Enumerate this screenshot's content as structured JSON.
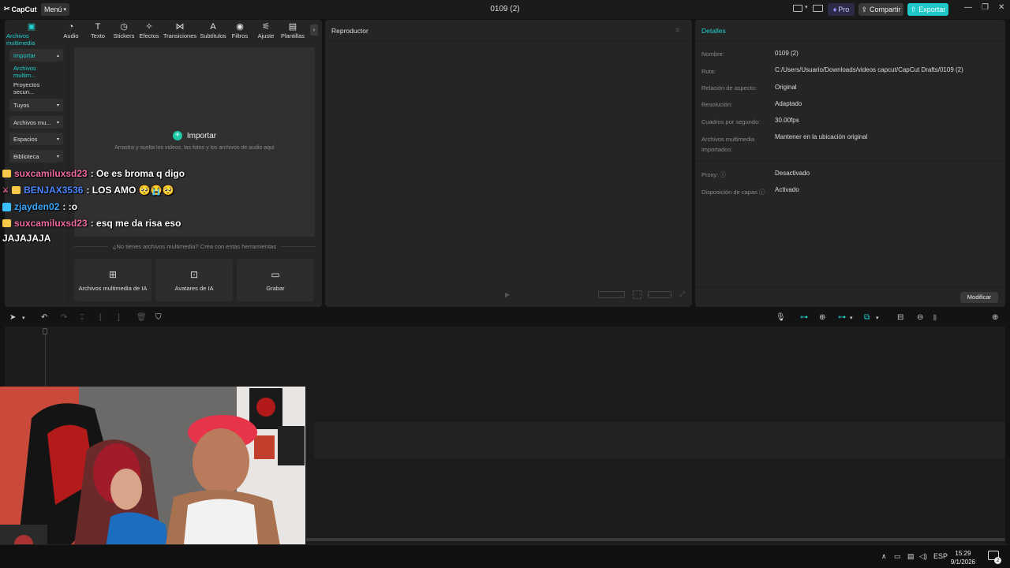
{
  "titlebar": {
    "logo": "CapCut",
    "menu": "Menú",
    "title": "0109 (2)",
    "pro": "Pro",
    "share": "Compartir",
    "export": "Exportar"
  },
  "media_tabs": [
    {
      "label": "Archivos multimedia",
      "icon": "media-icon"
    },
    {
      "label": "Audio",
      "icon": "audio-icon"
    },
    {
      "label": "Texto",
      "icon": "text-icon"
    },
    {
      "label": "Stickers",
      "icon": "sticker-icon"
    },
    {
      "label": "Efectos",
      "icon": "effects-icon"
    },
    {
      "label": "Transiciones",
      "icon": "transitions-icon"
    },
    {
      "label": "Subtítulos",
      "icon": "subtitles-icon"
    },
    {
      "label": "Filtros",
      "icon": "filters-icon"
    },
    {
      "label": "Ajuste",
      "icon": "adjust-icon"
    },
    {
      "label": "Plantillas",
      "icon": "templates-icon"
    }
  ],
  "sidebar": {
    "items": [
      {
        "label": "Importar"
      },
      {
        "label": "Archivos multim..."
      },
      {
        "label": "Proyectos secun..."
      },
      {
        "label": "Tuyos"
      },
      {
        "label": "Archivos mu..."
      },
      {
        "label": "Espacios"
      },
      {
        "label": "Biblioteca"
      }
    ]
  },
  "dropzone": {
    "title": "Importar",
    "subtitle": "Arrastra y suelta los videos, las fotos y los archivos de audio aquí"
  },
  "tools": {
    "prompt": "¿No tienes archivos multimedia? Crea con estas herramientas",
    "cards": [
      {
        "label": "Archivos multimedia de IA"
      },
      {
        "label": "Avatares de IA"
      },
      {
        "label": "Grabar"
      }
    ]
  },
  "player": {
    "title": "Reproductor"
  },
  "details": {
    "title": "Detalles",
    "rows": [
      {
        "label": "Nombre:",
        "value": "0109 (2)"
      },
      {
        "label": "Ruta:",
        "value": "C:/Users/Usuario/Downloads/videos capcut/CapCut Drafts/0109 (2)"
      },
      {
        "label": "Relación de aspecto:",
        "value": "Original"
      },
      {
        "label": "Resolución:",
        "value": "Adaptado"
      },
      {
        "label": "Cuadros por segundo:",
        "value": "30.00fps"
      },
      {
        "label": "Archivos multimedia importados:",
        "value": "Mantener en la ubicación original"
      },
      {
        "label": "Proxy:",
        "value": "Desactivado"
      },
      {
        "label": "Disposición de capas",
        "value": "Activado"
      }
    ],
    "modify": "Modificar"
  },
  "chat": [
    {
      "user": "suxcamiluxsd23",
      "message": ": Oe es broma q digo",
      "color": "#f06aa0"
    },
    {
      "user": "BENJAX3536",
      "message": ": LOS AMO 🥺😭🥺",
      "color": "#4a86ff"
    },
    {
      "user": "zjayden02",
      "message": ": :o",
      "color": "#3aa9ff"
    },
    {
      "user": "suxcamiluxsd23",
      "message": ": esq me da risa eso",
      "color": "#f06aa0"
    },
    {
      "user": "",
      "message": "JAJAJAJA",
      "color": "#ffffff"
    }
  ],
  "taskbar": {
    "lang": "ESP",
    "time": "15:29",
    "date": "9/1/2026",
    "notifications": "2"
  },
  "colors": {
    "accent": "#1fd1d1",
    "panel": "#252525",
    "background": "#131313"
  }
}
